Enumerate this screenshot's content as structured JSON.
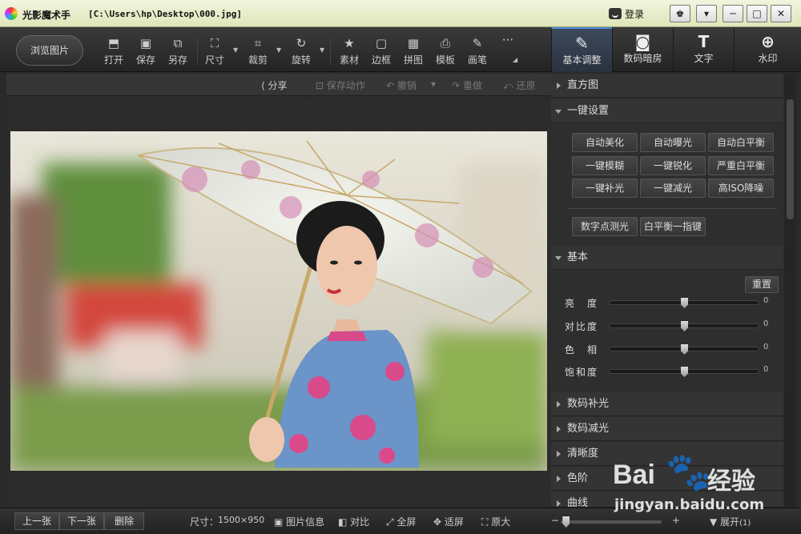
{
  "titlebar": {
    "app_name": "光影魔术手",
    "file_path": "[C:\\Users\\hp\\Desktop\\000.jpg]",
    "login_label": "登录",
    "controls": [
      "♚",
      "▾",
      "─",
      "□",
      "✕"
    ]
  },
  "toolbar": {
    "browse_label": "浏览图片",
    "tools": [
      {
        "label": "打开",
        "icon": "open-icon"
      },
      {
        "label": "保存",
        "icon": "save-icon"
      },
      {
        "label": "另存",
        "icon": "save-as-icon"
      },
      {
        "label": "尺寸",
        "icon": "resize-icon"
      },
      {
        "label": "裁剪",
        "icon": "crop-icon"
      },
      {
        "label": "旋转",
        "icon": "rotate-icon"
      },
      {
        "label": "素材",
        "icon": "material-icon"
      },
      {
        "label": "边框",
        "icon": "border-icon"
      },
      {
        "label": "拼图",
        "icon": "collage-icon"
      },
      {
        "label": "模板",
        "icon": "template-icon"
      },
      {
        "label": "画笔",
        "icon": "brush-icon"
      },
      {
        "label": "···",
        "icon": "more-icon"
      }
    ]
  },
  "right_tabs": [
    {
      "label": "基本调整",
      "icon": "adjust-icon",
      "active": true
    },
    {
      "label": "数码暗房",
      "icon": "darkroom-icon",
      "active": false
    },
    {
      "label": "文字",
      "icon": "text-icon",
      "active": false
    },
    {
      "label": "水印",
      "icon": "watermark-icon",
      "active": false
    }
  ],
  "subbar": {
    "share": "分享",
    "save_action": "保存动作",
    "undo": "撤销",
    "redo": "重做",
    "restore": "还原"
  },
  "panel": {
    "histogram": "直方图",
    "one_click": {
      "title": "一键设置",
      "buttons": [
        "自动美化",
        "自动曝光",
        "自动白平衡",
        "一键模糊",
        "一键锐化",
        "严重白平衡",
        "一键补光",
        "一键减光",
        "高ISO降噪"
      ],
      "extra_buttons": [
        "数字点测光",
        "白平衡一指键"
      ]
    },
    "basic": {
      "title": "基本",
      "reset": "重置",
      "sliders": [
        {
          "label": "亮　度",
          "value": "0",
          "level": 0.5
        },
        {
          "label": "对比度",
          "value": "0",
          "level": 0.5
        },
        {
          "label": "色　相",
          "value": "0",
          "level": 0.5
        },
        {
          "label": "饱和度",
          "value": "0",
          "level": 0.5
        }
      ]
    },
    "collapsed": [
      "数码补光",
      "数码减光",
      "清晰度",
      "色阶",
      "曲线"
    ]
  },
  "statusbar": {
    "prev": "上一张",
    "next": "下一张",
    "delete": "删除",
    "size_label": "尺寸：",
    "size_value": "1500×950",
    "info": "图片信息",
    "compare": "对比",
    "fullscreen": "全屏",
    "fit": "适屏",
    "original": "原大",
    "minus": "−",
    "plus": "+",
    "zoom_level": 0.05,
    "expand": "展开",
    "expand_count": "(1)"
  },
  "watermark": {
    "brand": "Bai",
    "brand_cn": "经验",
    "url": "jingyan.baidu.com"
  },
  "colors": {
    "accent": "#4a8fd6",
    "titlebar": "#e4ebc6"
  }
}
